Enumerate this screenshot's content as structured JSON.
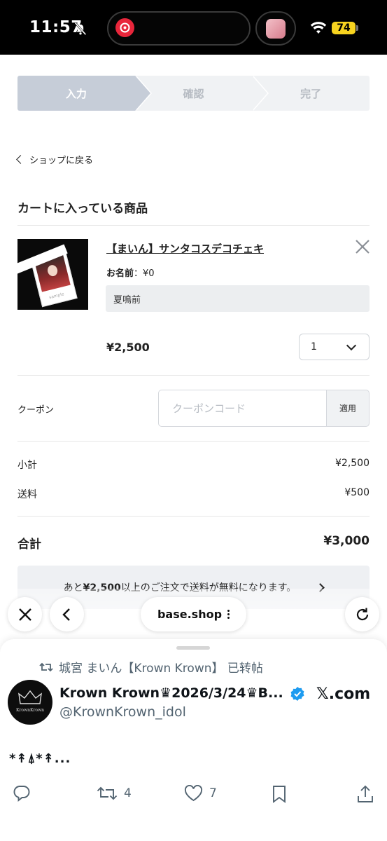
{
  "status_bar": {
    "time": "11:57",
    "battery": "74"
  },
  "stepper": {
    "steps": [
      "入力",
      "確認",
      "完了"
    ],
    "active_index": 0
  },
  "back_link": "ショップに戻る",
  "cart": {
    "title": "カートに入っている商品",
    "item": {
      "name": "【まいん】サンタコスデコチェキ",
      "option_label": "お名前",
      "option_price": "：¥0",
      "option_value": "夏鳴前",
      "price": "¥2,500",
      "quantity": "1",
      "thumb_watermark": "sample"
    }
  },
  "coupon": {
    "label": "クーポン",
    "placeholder": "クーポンコード",
    "apply_label": "適用"
  },
  "summary": {
    "subtotal_label": "小計",
    "subtotal_value": "¥2,500",
    "shipping_label": "送料",
    "shipping_value": "¥500",
    "total_label": "合計",
    "total_value": "¥3,000"
  },
  "free_shipping": {
    "prefix": "あと",
    "amount": "¥2,500",
    "suffix": "以上のご注文で送料が無料になります。"
  },
  "browser": {
    "url": "base.shop"
  },
  "tweet": {
    "repost_text": "城宮 まいん【Krown Krown】 已转帖",
    "author": "Krown Krown♛2026/3/24♛B...",
    "handle": "@KrownKrown_idol",
    "source": "𝕏.com",
    "text": "*↟⍋*↟...",
    "avatar_brand": "KrownKrown",
    "retweet_count": "4",
    "like_count": "7"
  },
  "colors": {
    "step_active": "#c6cdd8",
    "verified": "#1d9bf0",
    "app_red": "#e8263b",
    "battery": "#f7d31f"
  }
}
